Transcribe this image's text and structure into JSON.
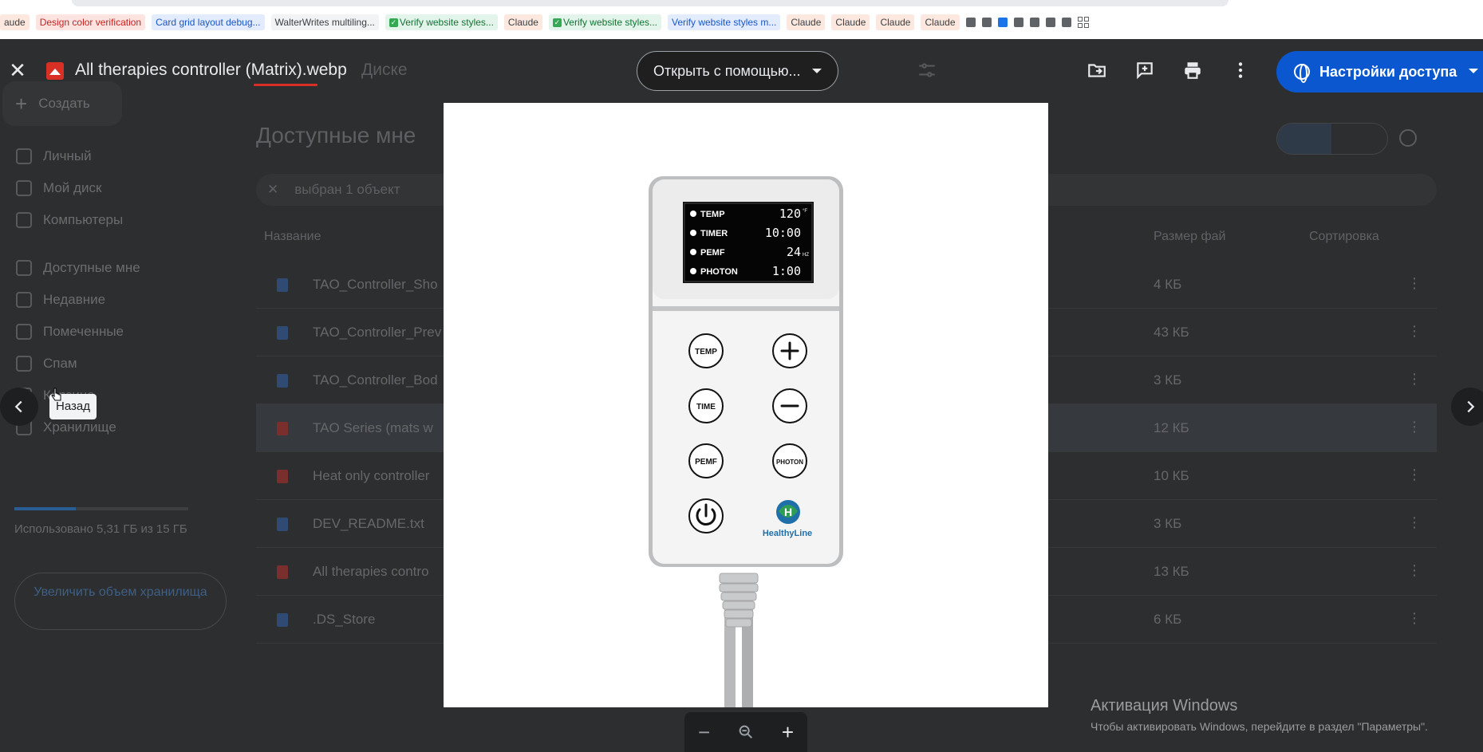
{
  "bookmarks": {
    "items": [
      {
        "label": "aude",
        "style": "peach",
        "icon": ""
      },
      {
        "label": "Design color verification",
        "style": "red",
        "icon": ""
      },
      {
        "label": "Card grid layout debug...",
        "style": "blue",
        "icon": ""
      },
      {
        "label": "WalterWrites multiling...",
        "style": "gray",
        "icon": ""
      },
      {
        "label": "Verify website styles...",
        "style": "green",
        "icon": "check"
      },
      {
        "label": "Claude",
        "style": "peach",
        "icon": ""
      },
      {
        "label": "Verify website styles...",
        "style": "green",
        "icon": "check"
      },
      {
        "label": "Verify website styles m...",
        "style": "blue",
        "icon": ""
      },
      {
        "label": "Claude",
        "style": "peach",
        "icon": ""
      },
      {
        "label": "Claude",
        "style": "peach",
        "icon": ""
      },
      {
        "label": "Claude",
        "style": "peach",
        "icon": ""
      },
      {
        "label": "Claude",
        "style": "peach",
        "icon": ""
      }
    ]
  },
  "viewer": {
    "file_title": "All therapies controller (Matrix).webp",
    "ghost_location": "Диске",
    "open_with_label": "Открыть с помощью...",
    "share_label": "Настройки доступа",
    "tooltip_back": "Назад",
    "colors": {
      "accent": "#0b57d0",
      "file_icon": "#d93025"
    }
  },
  "drive": {
    "create_label": "Создать",
    "nav": [
      {
        "label": "Личный",
        "icon": "home-icon"
      },
      {
        "label": "Мой диск",
        "icon": "drive-icon"
      },
      {
        "label": "Компьютеры",
        "icon": "computer-icon"
      },
      {
        "label": "Доступные мне",
        "icon": "shared-icon"
      },
      {
        "label": "Недавние",
        "icon": "clock-icon"
      },
      {
        "label": "Помеченные",
        "icon": "star-icon"
      },
      {
        "label": "Спам",
        "icon": "spam-icon"
      },
      {
        "label": "Корзина",
        "icon": "trash-icon"
      },
      {
        "label": "Хранилище",
        "icon": "cloud-icon"
      }
    ],
    "storage_text": "Использовано 5,31 ГБ из 15 ГБ",
    "storage_fraction": 0.354,
    "upgrade_label": "Увеличить объем хранилища",
    "page_title": "Доступные мне",
    "selection_text": "выбран 1 объект",
    "columns": {
      "name": "Название",
      "size": "Размер фай",
      "sort": "Сортировка"
    },
    "files": [
      {
        "name": "TAO_Controller_Sho",
        "size": "4 КБ",
        "type": "doc"
      },
      {
        "name": "TAO_Controller_Prev",
        "size": "43 КБ",
        "type": "doc"
      },
      {
        "name": "TAO_Controller_Bod",
        "size": "3 КБ",
        "type": "doc"
      },
      {
        "name": "TAO Series (mats w",
        "size": "12 КБ",
        "type": "img"
      },
      {
        "name": "Heat only controller",
        "size": "10 КБ",
        "type": "img"
      },
      {
        "name": "DEV_README.txt",
        "size": "3 КБ",
        "type": "doc"
      },
      {
        "name": "All therapies contro",
        "size": "13 КБ",
        "type": "img"
      },
      {
        "name": ".DS_Store",
        "size": "6 КБ",
        "type": "doc"
      }
    ]
  },
  "controller": {
    "lcd_rows": [
      {
        "label": "TEMP",
        "value": "120",
        "unit": "°F"
      },
      {
        "label": "TIMER",
        "value": "10:00",
        "unit": ""
      },
      {
        "label": "PEMF",
        "value": "24",
        "unit": "HZ"
      },
      {
        "label": "PHOTON",
        "value": "1:00",
        "unit": ""
      }
    ],
    "buttons": {
      "temp": "TEMP",
      "time": "TIME",
      "pemf": "PEMF",
      "photon": "PHOTON"
    },
    "brand": "HealthyLine"
  },
  "windows": {
    "activate_title": "Активация Windows",
    "activate_text": "Чтобы активировать Windows, перейдите в раздел \"Параметры\"."
  }
}
